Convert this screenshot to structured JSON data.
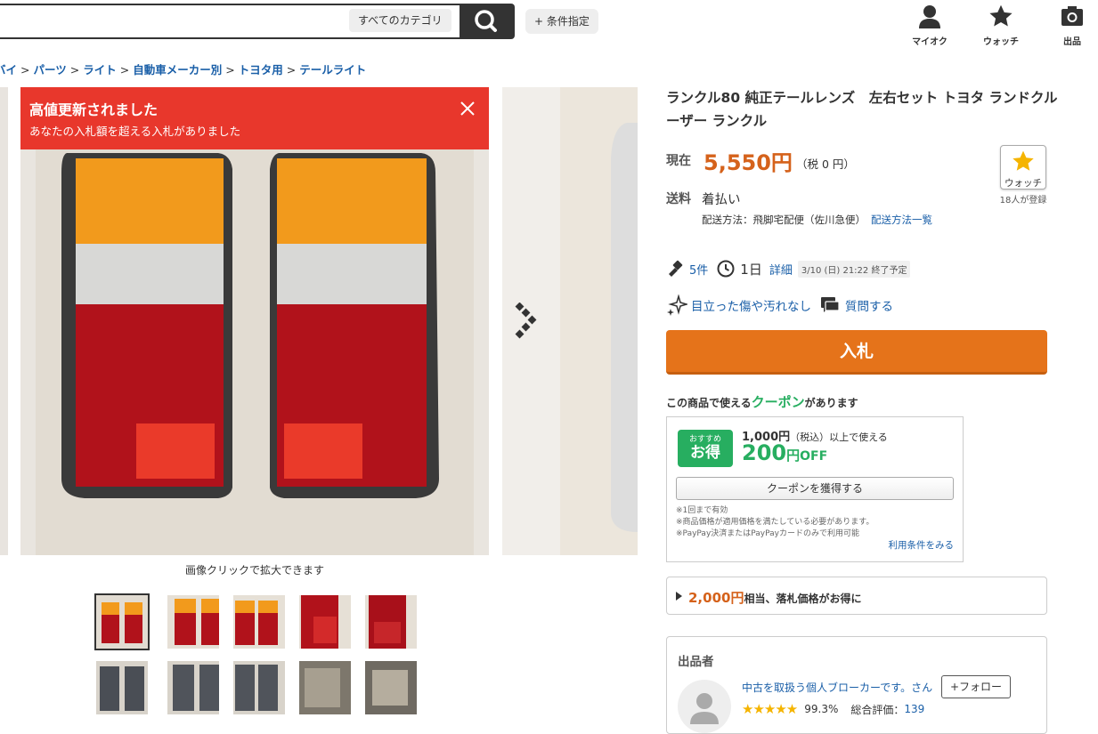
{
  "header": {
    "category_select": "すべてのカテゴリ",
    "conditions_button": "+ 条件指定",
    "icons": [
      {
        "name": "user-icon",
        "label": "マイオク"
      },
      {
        "name": "star-icon",
        "label": "ウォッチ"
      },
      {
        "name": "camera-icon",
        "label": "出品"
      }
    ]
  },
  "breadcrumb": [
    "バイ",
    "パーツ",
    "ライト",
    "自動車メーカー別",
    "トヨタ用",
    "テールライト"
  ],
  "alert": {
    "title": "高値更新されました",
    "message": "あなたの入札額を超える入札がありました"
  },
  "gallery": {
    "zoom_note": "画像クリックで拡大できます"
  },
  "item": {
    "title": "ランクル80 純正テールレンズ　左右セット トヨタ ランドクルーザー ランクル",
    "price_label": "現在",
    "price": "5,550円",
    "tax": "（税 0 円）",
    "watch_label": "ウォッチ",
    "watch_count": "18人が登録",
    "shipping_label": "送料",
    "shipping_value": "着払い",
    "shipping_method": "配送方法：飛脚宅配便（佐川急便）",
    "shipping_link": "配送方法一覧",
    "bids": "5件",
    "time_left": "1日",
    "detail_link": "詳細",
    "end_date": "3/10 (日) 21:22 終了予定",
    "condition": "目立った傷や汚れなし",
    "question_link": "質問する",
    "bid_button": "入札"
  },
  "coupon": {
    "head_pre": "この商品で使える",
    "head_cp": "クーポン",
    "head_post": "があります",
    "badge_small": "おすすめ",
    "badge_big": "お得",
    "condition_amt": "1,000円",
    "condition_rest": "（税込）以上で使える",
    "amount": "200",
    "amount_unit": "円",
    "off": "OFF",
    "get_button": "クーポンを獲得する",
    "notes": [
      "※1回まで有効",
      "※商品価格が適用価格を満たしている必要があります。",
      "※PayPay決済またはPayPayカードのみで利用可能"
    ],
    "terms_link": "利用条件をみる"
  },
  "deal": {
    "amount": "2,000円",
    "text": "相当、落札価格がお得に"
  },
  "seller": {
    "heading": "出品者",
    "name": "中古を取扱う個人ブローカーです。さん",
    "follow": "+フォロー",
    "percent": "99.3%",
    "total_label": "総合評価：",
    "total": "139"
  },
  "colors": {
    "accent_orange": "#e5731a",
    "price": "#d5621b",
    "alert_red": "#e8372c",
    "coupon_green": "#27ae60",
    "link_blue": "#1a5fa8"
  }
}
